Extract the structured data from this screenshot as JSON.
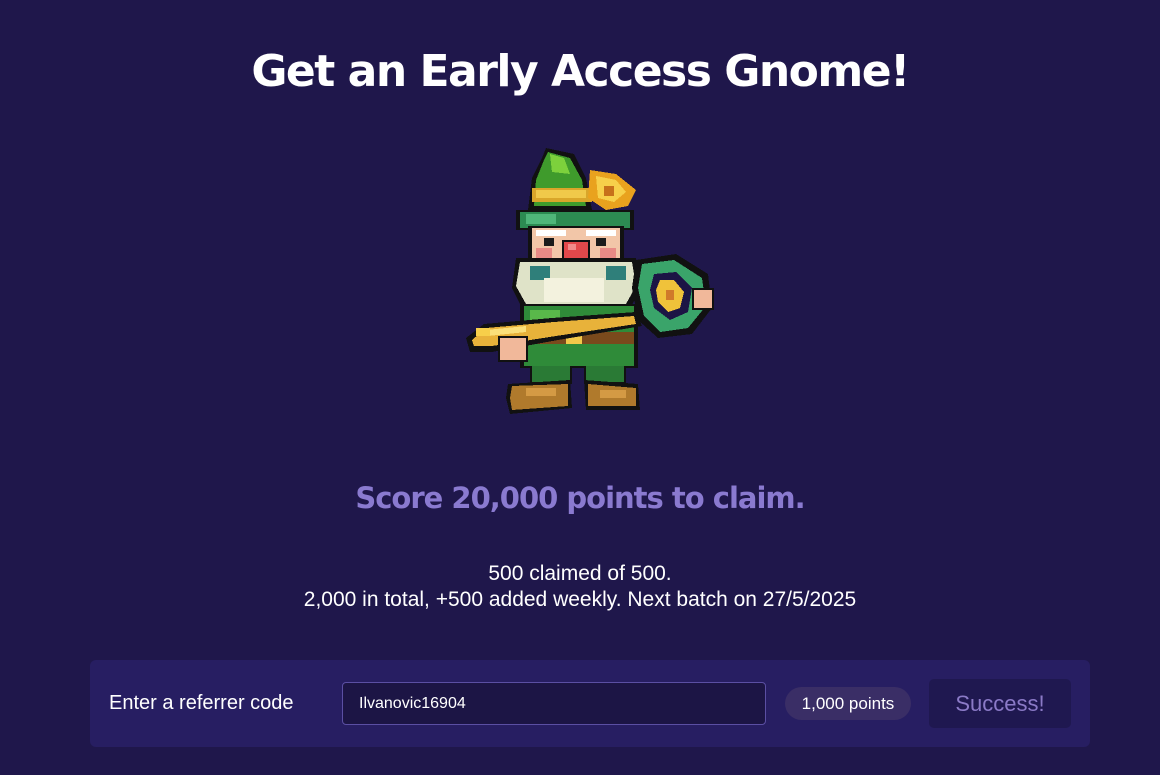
{
  "header": {
    "title": "Get an Early Access Gnome!"
  },
  "hero": {
    "image": "pixel-art-gnome-with-golden-key",
    "score_text": "Score 20,000 points to claim."
  },
  "status": {
    "claimed_text": "500 claimed of 500.",
    "batch_text": "2,000 in total, +500 added weekly. Next batch on 27/5/2025"
  },
  "referrer": {
    "label": "Enter a referrer code",
    "value": "Ilvanovic16904",
    "points_badge": "1,000 points",
    "button_label": "Success!"
  },
  "colors": {
    "background": "#1f174b",
    "panel": "#271e62",
    "accent_text": "#8a7ad0",
    "button_text": "#8b7ac7"
  }
}
